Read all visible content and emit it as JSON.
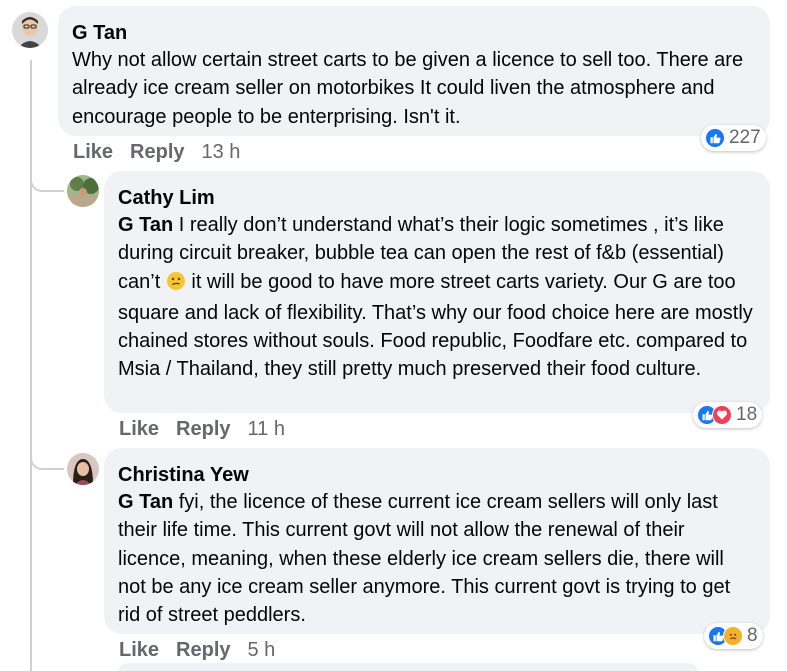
{
  "comments": [
    {
      "author": "G Tan",
      "mention": "",
      "text": "Why not allow certain street carts to be given a licence to sell too. There are already ice cream seller on motorbikes It could liven the atmosphere and encourage people to be enterprising. Isn't it.",
      "reactions": {
        "icons": [
          "like-icon"
        ],
        "count": "227"
      },
      "actions": {
        "like": "Like",
        "reply": "Reply",
        "time": "13 h"
      }
    },
    {
      "author": "Cathy Lim",
      "mention": "G Tan",
      "text_before_emoji": "I really don’t understand what’s their logic sometimes , it’s like during circuit breaker, bubble tea can open the rest of f&b (essential) can’t",
      "text_after_emoji": "it will be good to have more street carts variety. Our G are too square and lack of flexibility. That’s why our food choice here are mostly chained stores without souls. Food republic, Foodfare etc. compared to Msia / Thailand, they still pretty much preserved their food culture.",
      "reactions": {
        "icons": [
          "like-icon",
          "love-icon"
        ],
        "count": "18"
      },
      "actions": {
        "like": "Like",
        "reply": "Reply",
        "time": "11 h"
      }
    },
    {
      "author": "Christina Yew",
      "mention": "G Tan",
      "text": "fyi, the licence of these current ice cream sellers will only last their life time. This current govt will not allow the renewal of their licence, meaning, when these elderly ice cream sellers die, there will not be any ice cream seller anymore. This current govt is trying to get rid of street peddlers.",
      "reactions": {
        "icons": [
          "like-icon",
          "sad-icon"
        ],
        "count": "8"
      },
      "actions": {
        "like": "Like",
        "reply": "Reply",
        "time": "5 h"
      }
    }
  ],
  "colors": {
    "bubble": "#f0f2f5",
    "like_blue": "#1877f2",
    "love_red": "#f33e58",
    "sad_yellow": "#f7b125",
    "meta_gray": "#65676b"
  }
}
